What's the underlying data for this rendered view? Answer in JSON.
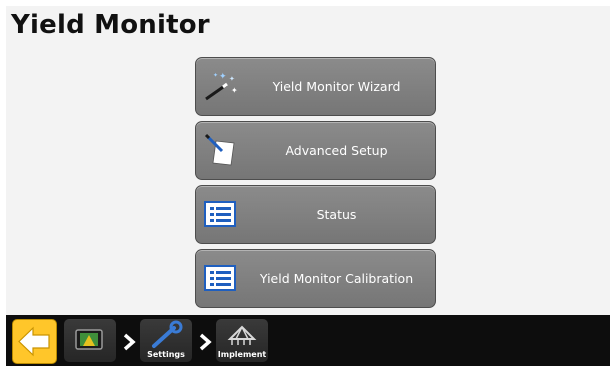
{
  "page": {
    "title": "Yield Monitor"
  },
  "menu": {
    "items": [
      {
        "label": "Yield Monitor Wizard",
        "icon": "magic-wand-icon"
      },
      {
        "label": "Advanced Setup",
        "icon": "pen-paper-icon"
      },
      {
        "label": "Status",
        "icon": "list-icon"
      },
      {
        "label": "Yield Monitor Calibration",
        "icon": "list-icon"
      }
    ]
  },
  "breadcrumb": {
    "home_icon": "back-arrow-icon",
    "items": [
      {
        "label": "",
        "icon": "display-screen-icon"
      },
      {
        "label": "Settings",
        "icon": "wrench-icon"
      },
      {
        "label": "Implement",
        "icon": "implement-icon"
      }
    ]
  },
  "colors": {
    "button_bg": "#808080",
    "bar_bg": "#0d0d0d",
    "home_button": "#ffc62a",
    "icon_blue": "#1f5fbf"
  }
}
